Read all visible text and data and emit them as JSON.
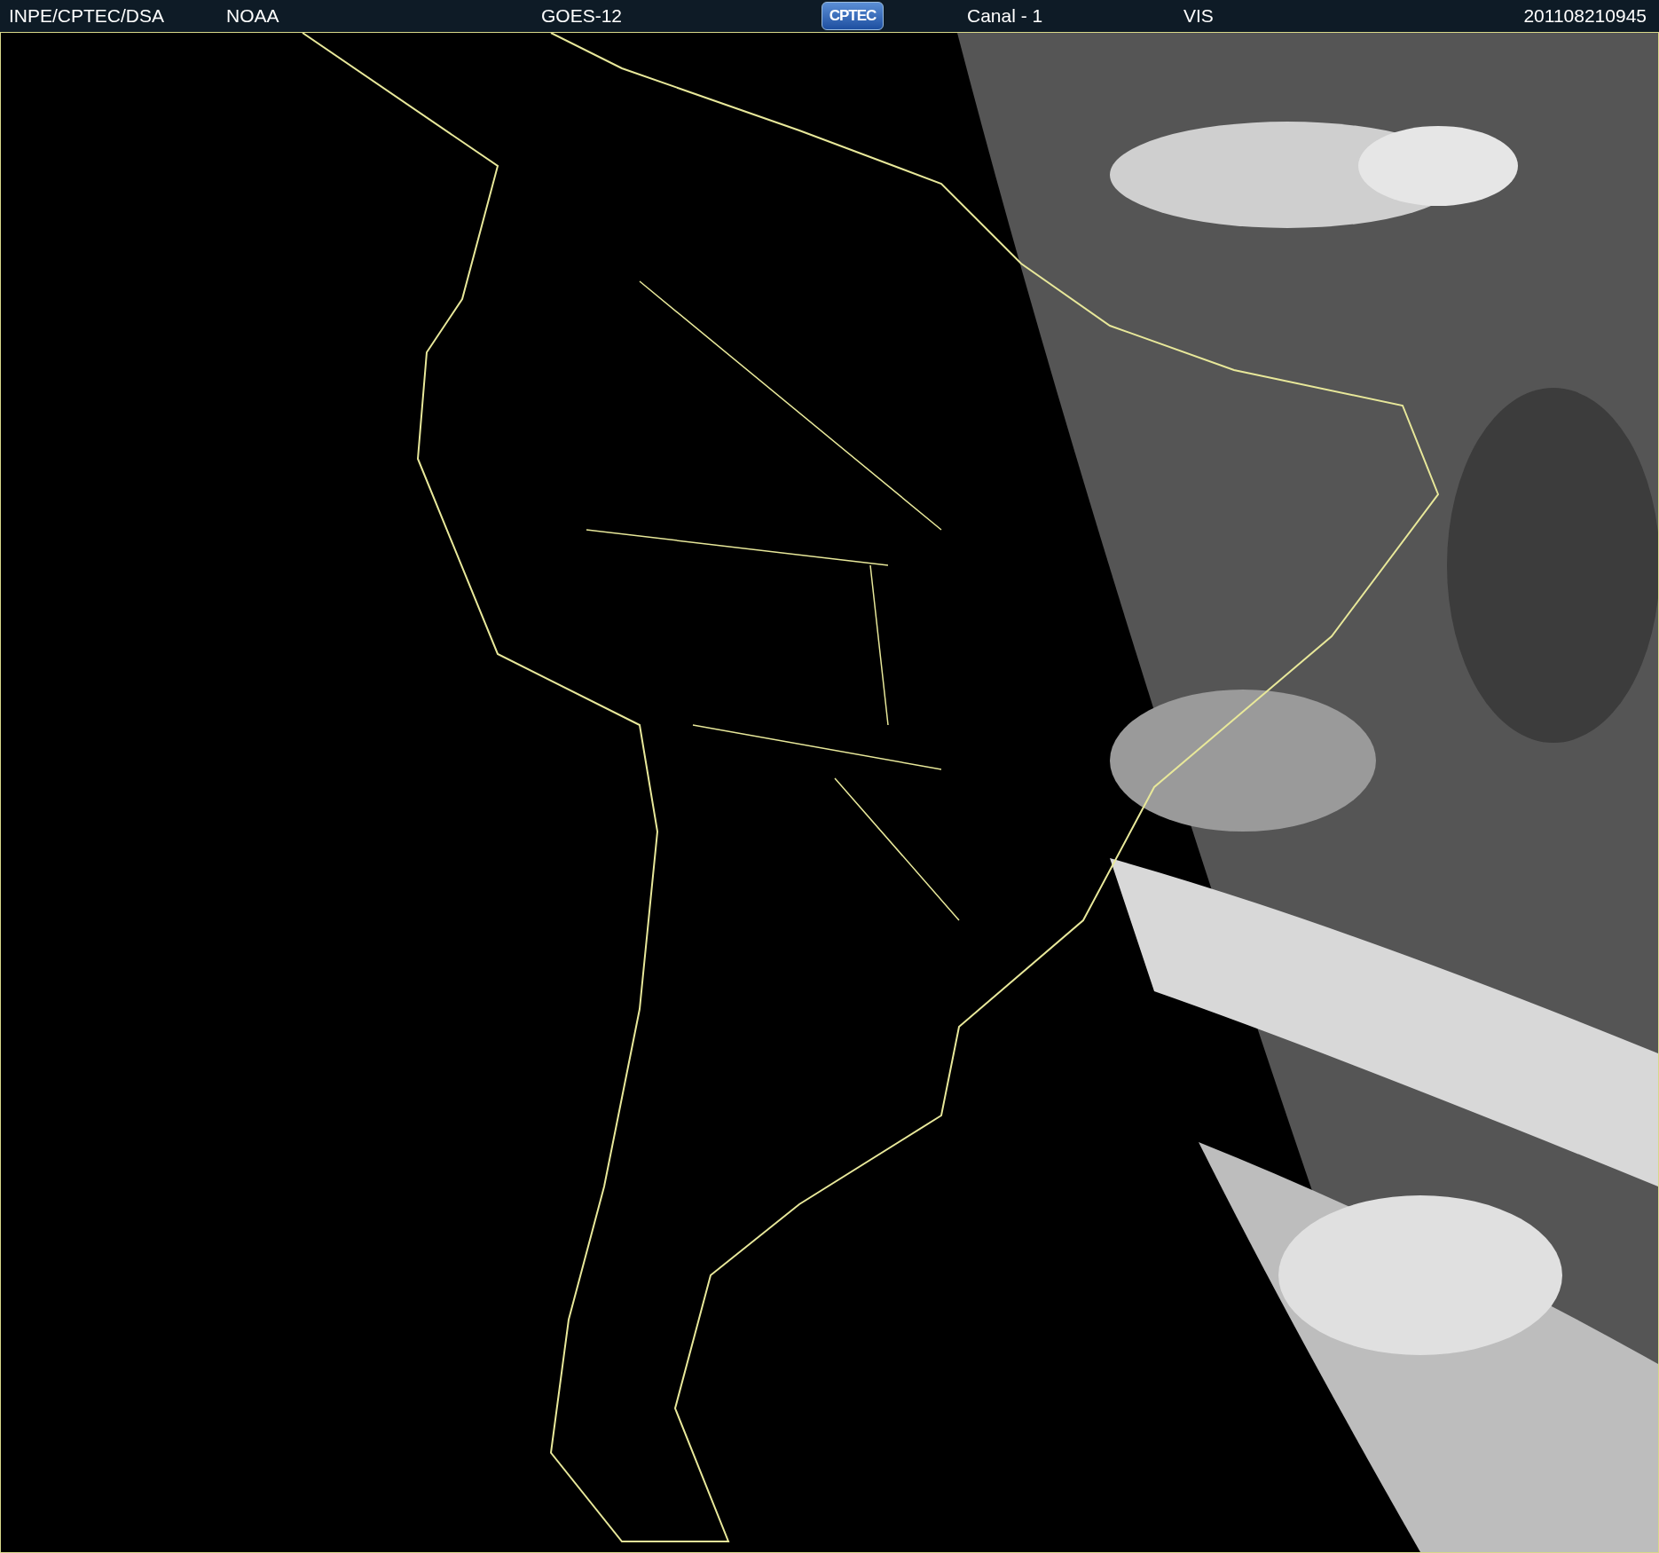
{
  "header": {
    "items": [
      {
        "kind": "text",
        "text": "INPE/CPTEC/DSA"
      },
      {
        "kind": "text",
        "text": "NOAA"
      },
      {
        "kind": "text",
        "text": "GOES-12"
      },
      {
        "kind": "logo",
        "text": "CPTEC"
      },
      {
        "kind": "text",
        "text": "Canal - 1"
      },
      {
        "kind": "text",
        "text": "VIS"
      },
      {
        "kind": "text",
        "text": "201108210945"
      }
    ]
  }
}
